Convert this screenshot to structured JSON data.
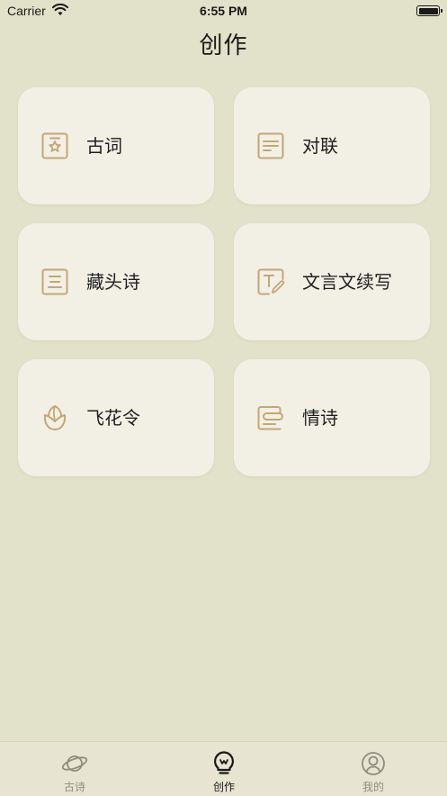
{
  "status_bar": {
    "carrier": "Carrier",
    "time": "6:55 PM",
    "wifi_icon": "wifi-icon",
    "battery_icon": "battery-icon"
  },
  "page": {
    "title": "创作"
  },
  "colors": {
    "background": "#e2e1c9",
    "card": "#f2f0e5",
    "accent_icon": "#c4a677",
    "tab_active": "#1a1a1a",
    "tab_inactive": "#8e8d7f"
  },
  "cards": [
    {
      "label": "古词",
      "icon": "star-card-icon"
    },
    {
      "label": "对联",
      "icon": "text-lines-icon"
    },
    {
      "label": "藏头诗",
      "icon": "three-lines-icon"
    },
    {
      "label": "文言文续写",
      "icon": "text-edit-icon"
    },
    {
      "label": "飞花令",
      "icon": "flower-icon"
    },
    {
      "label": "情诗",
      "icon": "letter-icon"
    }
  ],
  "tabs": [
    {
      "label": "古诗",
      "icon": "planet-icon",
      "active": false
    },
    {
      "label": "创作",
      "icon": "lightbulb-icon",
      "active": true
    },
    {
      "label": "我的",
      "icon": "user-circle-icon",
      "active": false
    }
  ]
}
